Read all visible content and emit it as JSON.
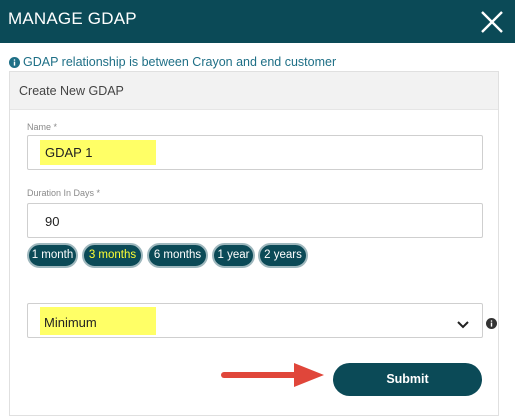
{
  "header": {
    "title": "MANAGE GDAP",
    "close_icon": "close-icon"
  },
  "info": {
    "text": "GDAP relationship is between Crayon and end customer",
    "icon": "info-circle-icon"
  },
  "card": {
    "title": "Create New GDAP"
  },
  "name_field": {
    "label": "Name *",
    "value": "GDAP 1"
  },
  "duration_field": {
    "label": "Duration In Days *",
    "value": "90"
  },
  "duration_presets": [
    {
      "label": "1 month",
      "selected": false
    },
    {
      "label": "3 months",
      "selected": true
    },
    {
      "label": "6 months",
      "selected": false
    },
    {
      "label": "1 year",
      "selected": false
    },
    {
      "label": "2 years",
      "selected": false
    }
  ],
  "role_select": {
    "value": "Minimum",
    "chevron_icon": "chevron-down-icon",
    "info_icon": "info-circle-icon"
  },
  "submit": {
    "label": "Submit"
  },
  "colors": {
    "header_bg": "#0b4a57",
    "highlight": "#ffff66",
    "arrow": "#e0463a",
    "info_text": "#1e6f86"
  }
}
